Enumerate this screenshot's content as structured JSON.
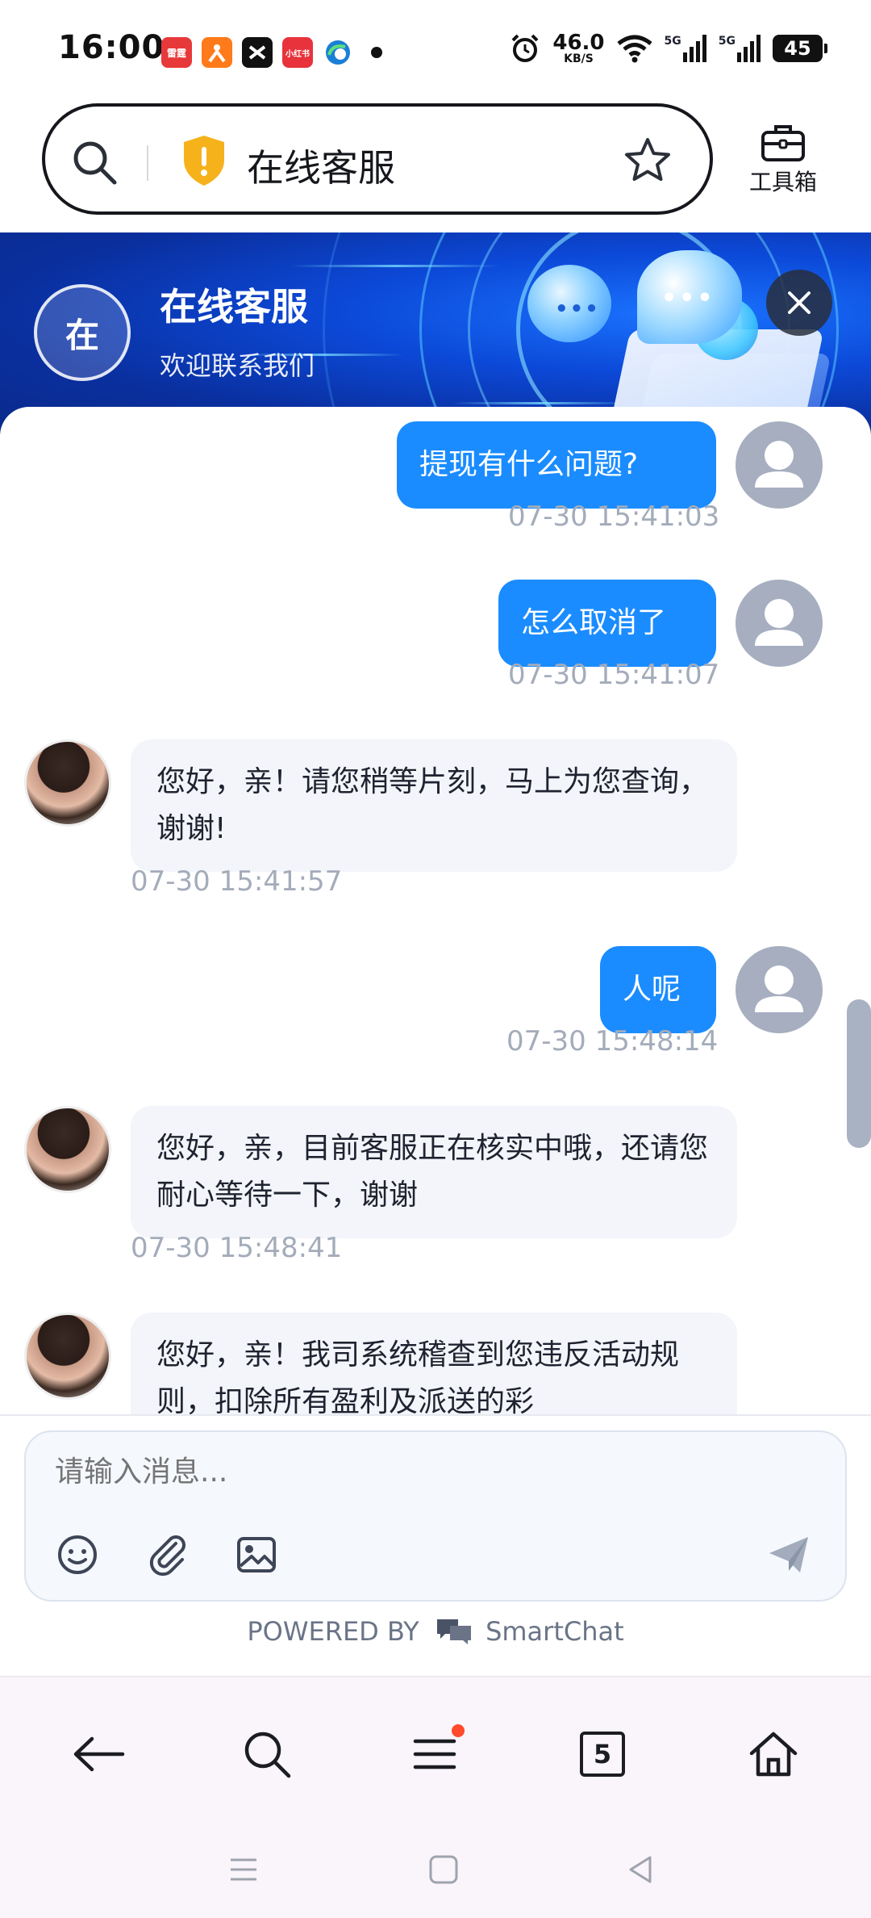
{
  "status_bar": {
    "time": "16:00",
    "apps": [
      {
        "name": "雷霆",
        "color": "#e8393a"
      },
      {
        "name": "orange-app",
        "color": "#ff7a1a"
      },
      {
        "name": "capcut",
        "color": "#111111"
      },
      {
        "name": "小红书",
        "color": "#e8333c"
      },
      {
        "name": "edge-browser",
        "color": "#1a7fd6"
      }
    ],
    "net_speed_value": "46.0",
    "net_speed_unit": "KB/S",
    "signal_1": "5G",
    "signal_2": "5G",
    "battery": "45"
  },
  "address_bar": {
    "title": "在线客服",
    "toolbox_label": "工具箱"
  },
  "chat_header": {
    "avatar_text": "在",
    "title": "在线客服",
    "subtitle": "欢迎联系我们"
  },
  "messages": [
    {
      "side": "out",
      "text": "提现有什么问题?",
      "time": "07-30 15:41:03"
    },
    {
      "side": "out",
      "text": "怎么取消了",
      "time": "07-30 15:41:07"
    },
    {
      "side": "in",
      "text": "您好，亲！请您稍等片刻，马上为您查询，谢谢!",
      "time": "07-30 15:41:57"
    },
    {
      "side": "out",
      "text": "人呢",
      "time": "07-30 15:48:14"
    },
    {
      "side": "in",
      "text": "您好，亲，目前客服正在核实中哦，还请您耐心等待一下，谢谢",
      "time": "07-30 15:48:41"
    },
    {
      "side": "in",
      "text": "您好，亲！我司系统稽查到您违反活动规则，扣除所有盈利及派送的彩",
      "time": ""
    }
  ],
  "composer": {
    "placeholder": "请输入消息..."
  },
  "powered_by": {
    "prefix": "POWERED BY",
    "brand": "SmartChat"
  },
  "bottom_nav": {
    "tabs_count": "5"
  },
  "colors": {
    "accent": "#1a8cff",
    "banner": "#0c49d8",
    "incoming_bubble": "#f3f5fa",
    "timestamp": "#a4acba"
  }
}
